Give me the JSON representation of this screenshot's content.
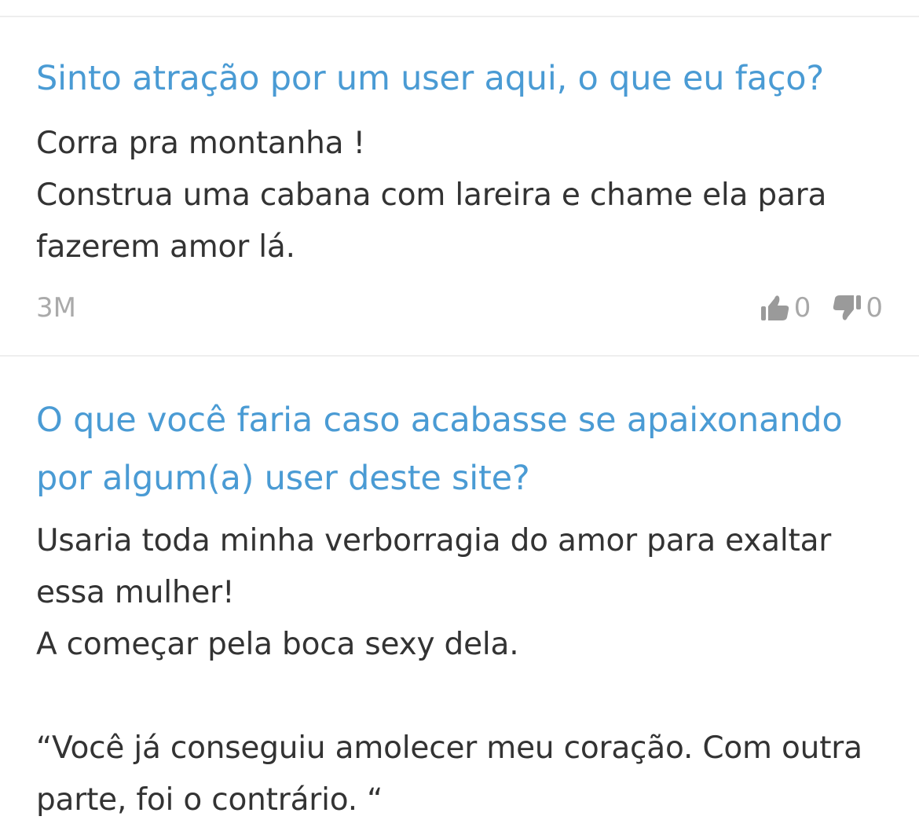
{
  "posts": [
    {
      "title": "Sinto atração por um user aqui, o que eu faço?",
      "body": "Corra pra montanha !\nConstrua uma cabana com lareira e chame ela para fazerem amor lá.",
      "timestamp": "3M",
      "likes": "0",
      "dislikes": "0"
    },
    {
      "title": "O que você faria caso acabasse se apaixonando por algum(a) user deste site?",
      "body": "Usaria toda minha verborragia do amor para exaltar essa mulher!\nA começar pela boca sexy dela.\n\n“Você já conseguiu amolecer meu coração. Com outra parte, foi o contrário. “"
    }
  ],
  "icons": {
    "like": "thumbs-up-icon",
    "dislike": "thumbs-down-icon"
  },
  "colors": {
    "title": "#4a9bd4",
    "body": "#333333",
    "meta": "#aaaaaa",
    "icon": "#9a9a9a",
    "divider": "#eeeeee"
  }
}
